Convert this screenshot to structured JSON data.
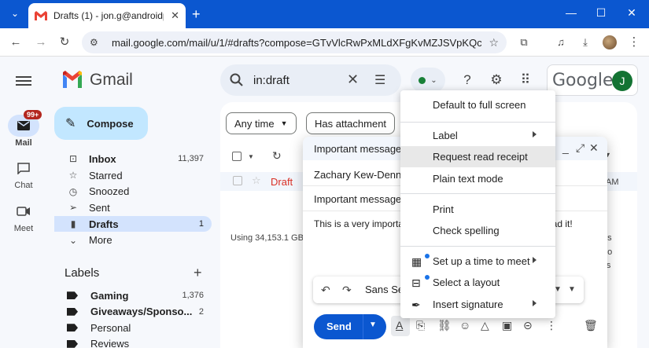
{
  "browser": {
    "tab_title": "Drafts (1) - jon.g@androidpolic",
    "url": "mail.google.com/mail/u/1/#drafts?compose=GTvVlcRwPxMLdXFgKvMZJSVpKQcXFRDg...",
    "new_tab_symbol": "+"
  },
  "gmail": {
    "app_name": "Gmail",
    "rail": {
      "mail_label": "Mail",
      "mail_badge": "99+",
      "chat_label": "Chat",
      "meet_label": "Meet"
    },
    "compose_label": "Compose",
    "folders": [
      {
        "label": "Inbox",
        "count": "11,397",
        "icon": "inbox-icon"
      },
      {
        "label": "Starred",
        "count": "",
        "icon": "star-icon"
      },
      {
        "label": "Snoozed",
        "count": "",
        "icon": "clock-icon"
      },
      {
        "label": "Sent",
        "count": "",
        "icon": "send-icon"
      },
      {
        "label": "Drafts",
        "count": "1",
        "icon": "draft-icon"
      },
      {
        "label": "More",
        "count": "",
        "icon": "chevron-down-icon"
      }
    ],
    "labels_title": "Labels",
    "labels": [
      {
        "name": "Gaming",
        "count": "1,376"
      },
      {
        "name": "Giveaways/Sponso...",
        "count": "2"
      },
      {
        "name": "Personal",
        "count": ""
      },
      {
        "name": "Reviews",
        "count": ""
      }
    ],
    "search_query": "in:draft",
    "google_wordmark": "Google",
    "avatar_initial": "J",
    "filters": {
      "any_time": "Any time",
      "has_attachment": "Has attachment"
    },
    "draft_row": {
      "label": "Draft",
      "time_fragment": "AM"
    },
    "storage_text": "Using 34,153.1 GB",
    "right_clipped": [
      "es",
      "go",
      "ils"
    ]
  },
  "compose_window": {
    "title": "Important message",
    "to": "Zachary Kew-Dennis",
    "subject": "Important message!",
    "body_start": "This is a very importar",
    "body_end": "ead it!",
    "font_name": "Sans Se",
    "send_label": "Send",
    "accent": "#0b57d0"
  },
  "menu": {
    "items": [
      {
        "label": "Default to full screen",
        "arrow": false
      },
      {
        "label": "Label",
        "arrow": true
      },
      {
        "label": "Request read receipt",
        "arrow": false
      },
      {
        "label": "Plain text mode",
        "arrow": false
      },
      {
        "label": "Print",
        "arrow": false
      },
      {
        "label": "Check spelling",
        "arrow": false
      },
      {
        "label": "Set up a time to meet",
        "arrow": true
      },
      {
        "label": "Select a layout",
        "arrow": false
      },
      {
        "label": "Insert signature",
        "arrow": true
      }
    ]
  }
}
